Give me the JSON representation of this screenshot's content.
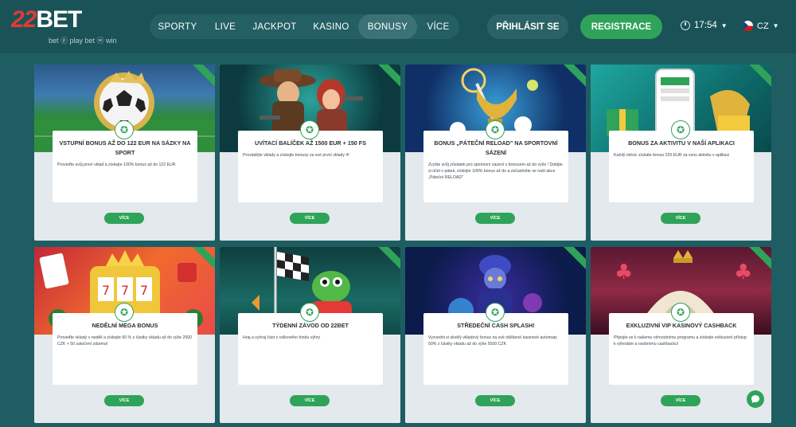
{
  "header": {
    "logo": {
      "main_22": "22",
      "main_bet": "BET",
      "tagline": "bet ⓟ play  bet ⓦ win"
    },
    "nav": [
      {
        "label": "SPORTY"
      },
      {
        "label": "LIVE"
      },
      {
        "label": "JACKPOT"
      },
      {
        "label": "KASINO"
      },
      {
        "label": "BONUSY"
      },
      {
        "label": "VÍCE"
      }
    ],
    "login_label": "PŘIHLÁSIT SE",
    "register_label": "REGISTRACE",
    "time": "17:54",
    "language": "CZ"
  },
  "cards": [
    {
      "title": "VSTUPNÍ BONUS AŽ DO 122 EUR NA SÁZKY NA SPORT",
      "description": "Proveďte svůj první vklad a získejte 100% bonus až do 122 EUR",
      "button": "VÍCE",
      "art": "football-icon"
    },
    {
      "title": "UVÍTACÍ BALÍČEK AŽ 1500 EUR + 150 FS",
      "description": "Provádějte vklady a získejte bonusy za své první vklady 4!",
      "button": "VÍCE",
      "art": "casino-characters-icon"
    },
    {
      "title": "BONUS „PÁTEČNÍ RELOAD\" NA SPORTOVNÍ SÁZENÍ",
      "description": "Zvyšte svůj zůstatek pro sportovní sázení s bonusem až do výše ! Dobijte si účet v pátek, získejte 100% bonus až do a zúčastněte se naší akce „Páteční RELOAD\"",
      "button": "VÍCE",
      "art": "trophy-icon"
    },
    {
      "title": "BONUS ZA AKTIVITU V NAŠÍ APLIKACI",
      "description": "Každý měsíc získáte bonus 220 EUR za svou aktivitu v aplikaci",
      "button": "VÍCE",
      "art": "app-phone-icon"
    },
    {
      "title": "NEDĚLNÍ MEGA BONUS",
      "description": "Proveďte vklady v neděli a získejte 66 % z částky vkladu až do výše 2500 CZK + 50 zatočení zdarma!",
      "button": "VÍCE",
      "art": "slot-machine-icon"
    },
    {
      "title": "TÝDENNÍ ZÁVOD OD 22BET",
      "description": "Hraj a vyhraj část z celkového fondu výhry",
      "button": "VÍCE",
      "art": "race-flag-icon"
    },
    {
      "title": "STŘEDEČNÍ CASH SPLASH!",
      "description": "Vyzvedni si skvělý vkladový bonus na své oblíbené kasinové automaty 50% z částky vkladu až do výše 5500 CZK",
      "button": "VÍCE",
      "art": "wizard-icon"
    },
    {
      "title": "EXKLUZIVNÍ VIP KASINOVÝ CASHBACK",
      "description": "Připojte se k našemu věrnostnímu programu a získejte exkluzivní přístup k výhodám a osobnímu cashbacku!",
      "button": "VÍCE",
      "art": "vip-crown-icon"
    }
  ],
  "colors": {
    "accent": "#2fa35a",
    "header_bg": "#1a5357",
    "page_bg": "#1e5e62"
  }
}
